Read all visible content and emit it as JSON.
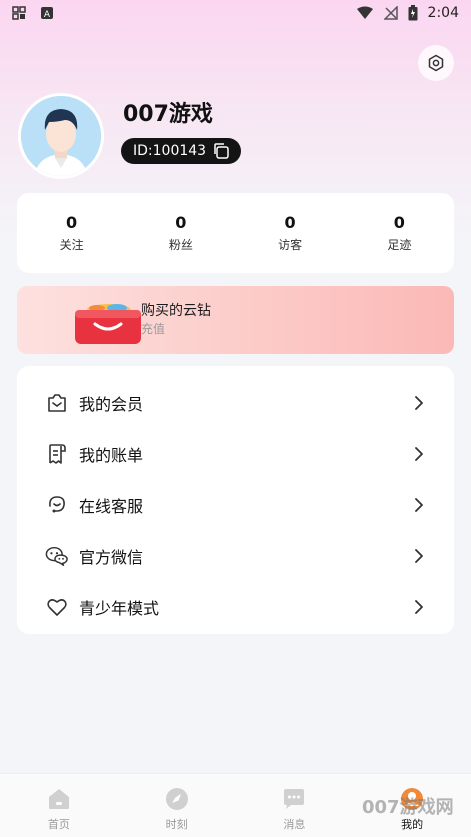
{
  "status_bar": {
    "time": "2:04"
  },
  "profile": {
    "username": "007游戏",
    "user_id": "ID:100143"
  },
  "stats": [
    {
      "value": "0",
      "label": "关注"
    },
    {
      "value": "0",
      "label": "粉丝"
    },
    {
      "value": "0",
      "label": "访客"
    },
    {
      "value": "0",
      "label": "足迹"
    }
  ],
  "promo": {
    "title": "购买的云钻",
    "subtitle": "充值"
  },
  "menu": [
    {
      "label": "我的会员",
      "icon": "membership-icon"
    },
    {
      "label": "我的账单",
      "icon": "bill-icon"
    },
    {
      "label": "在线客服",
      "icon": "customer-service-icon"
    },
    {
      "label": "官方微信",
      "icon": "wechat-icon"
    },
    {
      "label": "青少年模式",
      "icon": "heart-icon"
    }
  ],
  "tabs": [
    {
      "label": "首页",
      "icon": "home-icon"
    },
    {
      "label": "时刻",
      "icon": "compass-icon"
    },
    {
      "label": "消息",
      "icon": "chat-icon"
    },
    {
      "label": "我的",
      "icon": "profile-icon"
    }
  ],
  "watermark": "007游戏网",
  "colors": {
    "accent_pink": "#fbd6f1",
    "promo_red": "#f0454f",
    "tab_active_badge": "#f08a3a"
  }
}
